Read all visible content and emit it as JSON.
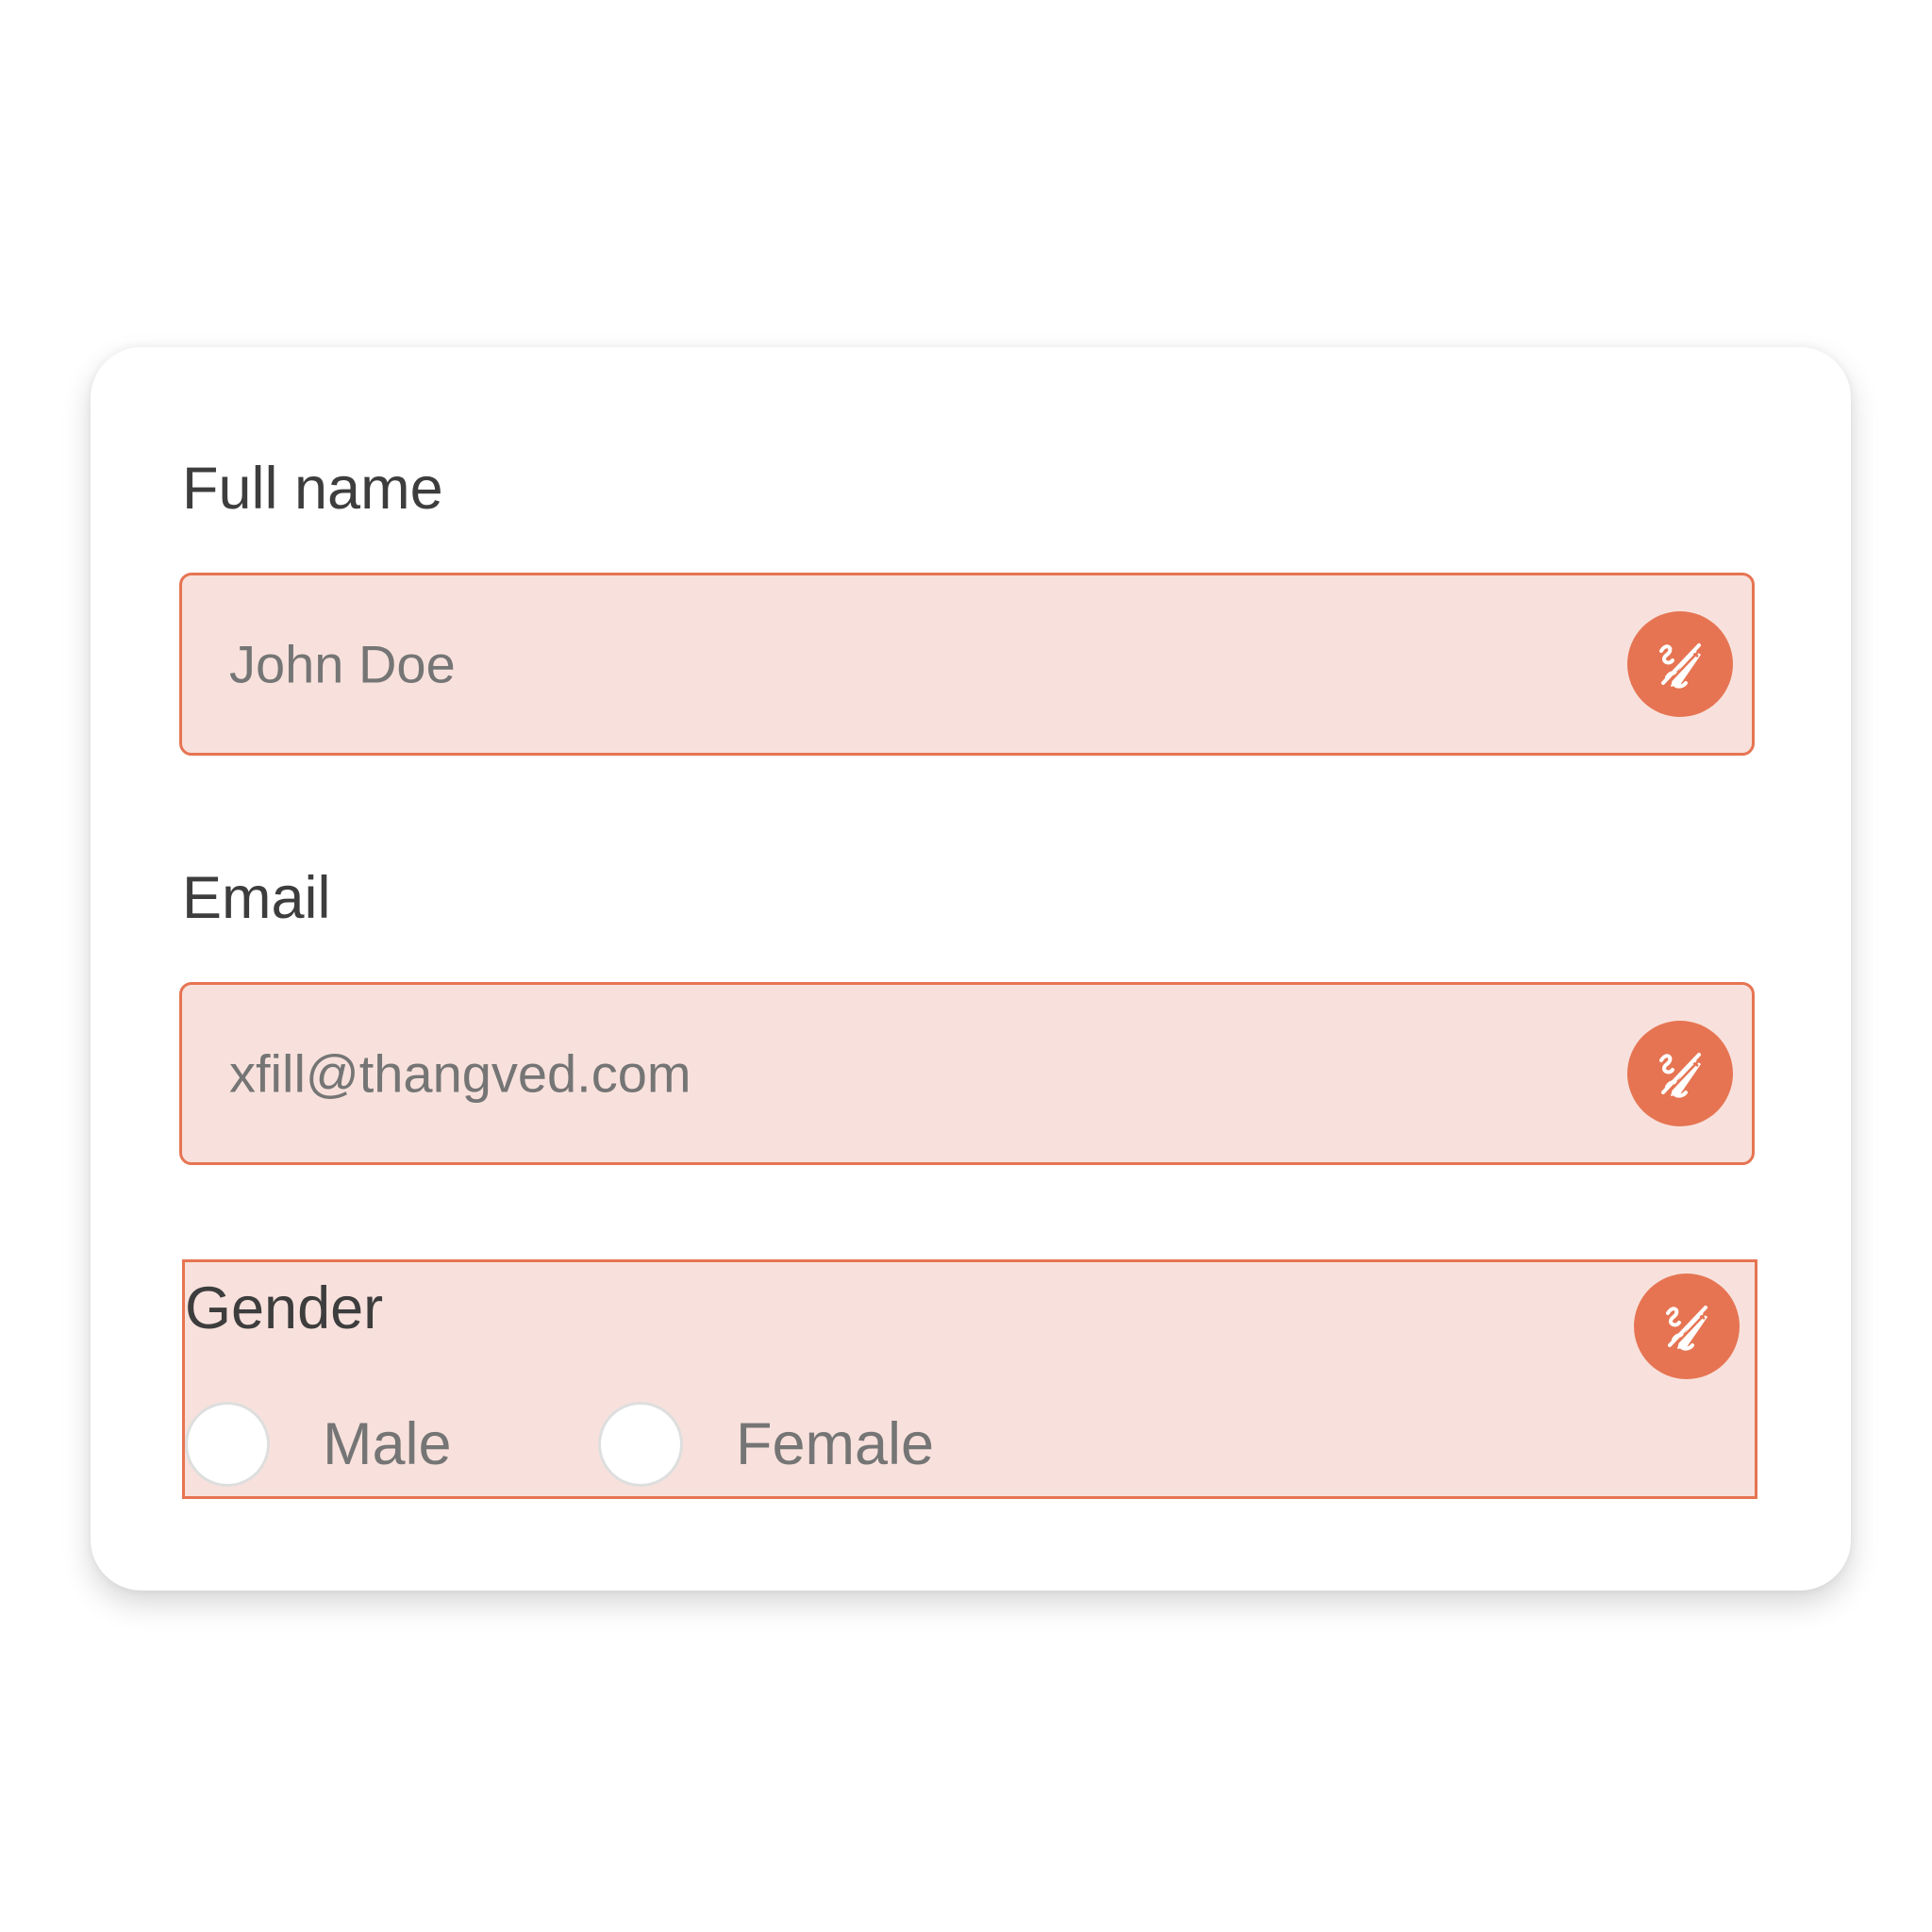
{
  "accent_color": "#e67452",
  "field_bg_color": "#f8e1dc",
  "form": {
    "full_name": {
      "label": "Full name",
      "value": "John Doe",
      "fill_icon": "magic-fill-icon"
    },
    "email": {
      "label": "Email",
      "value": "xfill@thangved.com",
      "fill_icon": "magic-fill-icon"
    },
    "gender": {
      "label": "Gender",
      "fill_icon": "magic-fill-icon",
      "options": [
        {
          "label": "Male",
          "selected": false
        },
        {
          "label": "Female",
          "selected": false
        }
      ]
    }
  }
}
